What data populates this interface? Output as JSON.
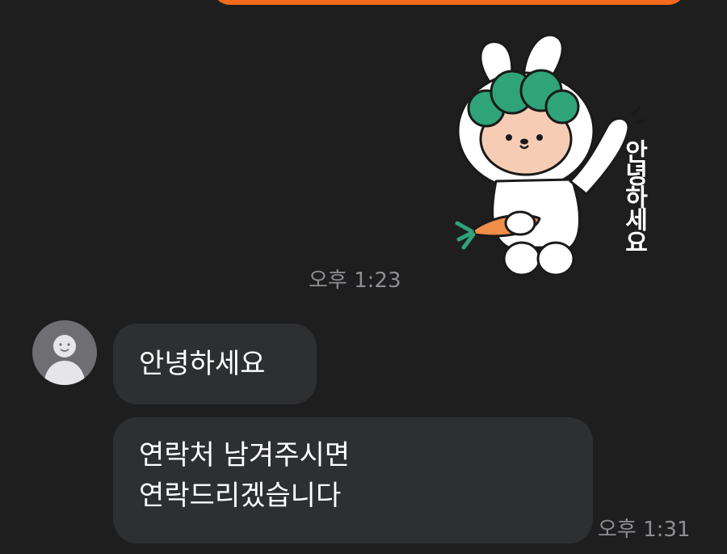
{
  "chat": {
    "sticker": {
      "name": "bunny-waving-sticker",
      "caption": "안녕하세요",
      "time": "오후 1:23"
    },
    "incoming": {
      "avatar_icon": "default-profile-icon",
      "messages": [
        {
          "text": "안녕하세요"
        },
        {
          "lines": [
            "연락처 남겨주시면",
            "연락드리겠습니다"
          ]
        }
      ],
      "time": "오후 1:31"
    }
  },
  "colors": {
    "background": "#1e1e1f",
    "incoming_bubble": "#2e2f31",
    "outgoing_bubble": "#f26a1b",
    "timestamp": "#8e8e93",
    "sticker_green": "#2fa37a"
  }
}
